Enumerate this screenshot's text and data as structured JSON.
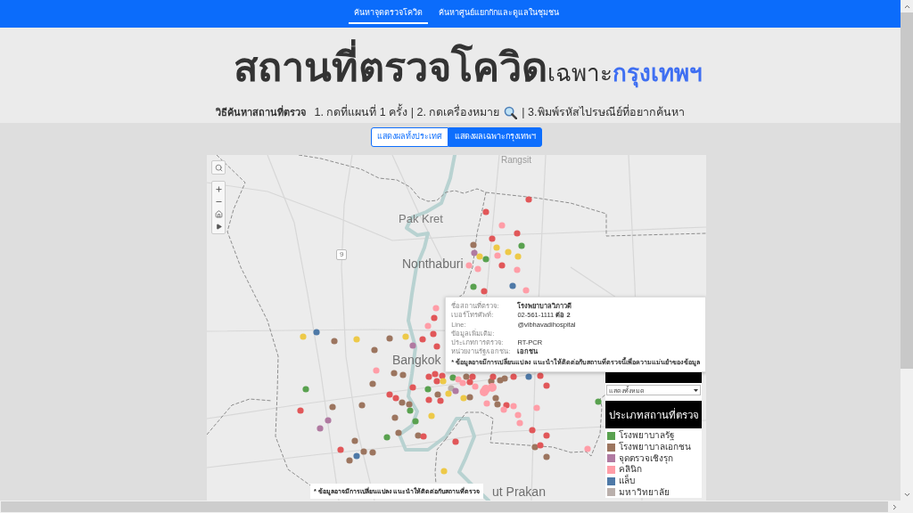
{
  "nav": {
    "links": [
      {
        "label": "ค้นหาจุดตรวจโควิด",
        "selected": true
      },
      {
        "label": "ค้นหาศูนย์แยกกักและดูแลในชุมชน",
        "selected": false
      }
    ]
  },
  "header": {
    "title": "สถานที่ตรวจโควิด",
    "title_suffix": "เฉพาะ",
    "title_highlight": "กรุงเทพฯ",
    "instructions": {
      "heading": "วิธีค้นหาสถานที่ตรวจ",
      "before_icon": "1. กดที่แผนที่ 1 ครั้ง | 2. กดเครื่องหมาย",
      "after_icon": "| 3.พิมพ์รหัสไปรษณีย์ที่อยากค้นหา"
    }
  },
  "scope_buttons": [
    {
      "label": "แสดงผลทั้งประเทศ",
      "selected": false
    },
    {
      "label": "แสดงผลเฉพาะกรุงเทพฯ",
      "selected": true
    }
  ],
  "map": {
    "place_labels": [
      {
        "label": "Rangsit",
        "kind": "suburb"
      },
      {
        "label": "Pak Kret",
        "kind": "town"
      },
      {
        "label": "Nonthaburi",
        "kind": "city"
      },
      {
        "label": "Bangkok",
        "kind": "city"
      },
      {
        "label": "ut Prakan",
        "kind": "city"
      }
    ],
    "road_shields": [
      "9"
    ],
    "note": "* ข้อมูลอาจมีการเปลี่ยนแปลง แนะนำให้ติดต่อกับสถานที่ตรวจ",
    "tooltip": {
      "rows": [
        {
          "label": "ชื่อสถานที่ตรวจ:",
          "value": "โรงพยาบาลวิภาวดี",
          "bold": true
        },
        {
          "label": "เบอร์โทรศัพท์:",
          "value": "02-561-1111 **ต่อ 2**",
          "bold": false
        },
        {
          "label": "Line:",
          "value": "@vibhavadihospital",
          "bold": false
        },
        {
          "label": "ข้อมูลเพิ่มเติม:"
        },
        {
          "label": "ประเภทการตรวจ:",
          "value": "RT-PCR",
          "bold": false
        },
        {
          "label": "หน่วยงานรัฐ/เอกชน:",
          "value": "เอกชน",
          "bold": true
        }
      ],
      "note": "* ข้อมูลอาจมีการเปลี่ยนแปลง แนะนำให้ติดต่อกับสถานที่ตรวจนี้เพื่อความแม่นยำของข้อมูล"
    }
  },
  "filter": {
    "dropdown_value": "แสดงทั้งหมด"
  },
  "legend": {
    "title": "ประเภทสถานที่ตรวจ",
    "items": [
      {
        "label": "โรงพยาบาลรัฐ",
        "color": "#59a14f"
      },
      {
        "label": "โรงพยาบาลเอกชน",
        "color": "#9c755f"
      },
      {
        "label": "จุดตรวจเชิงรุก",
        "color": "#b07aa1"
      },
      {
        "label": "คลินิก",
        "color": "#ff9da7"
      },
      {
        "label": "แล็บ",
        "color": "#4e79a7"
      },
      {
        "label": "มหาวิทยาลัย",
        "color": "#bab0ac"
      }
    ]
  }
}
